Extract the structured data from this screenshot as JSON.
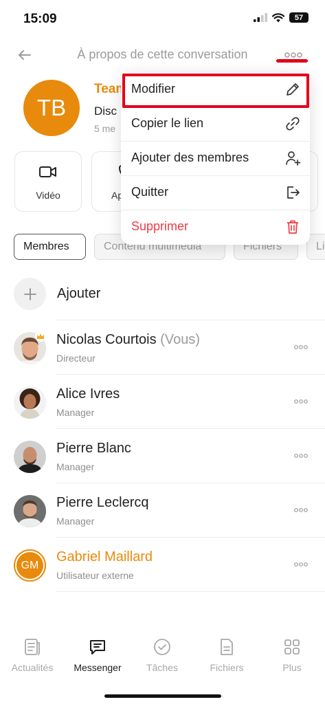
{
  "status_bar": {
    "time": "15:09",
    "battery": "57"
  },
  "header": {
    "title": "À propos de cette conversation"
  },
  "conversation": {
    "initials": "TB",
    "name": "Team",
    "type": "Disc",
    "members": "5 me"
  },
  "actions": [
    {
      "label": "Vidéo",
      "icon": "video-camera-icon"
    },
    {
      "label": "Ap",
      "icon": "phone-icon"
    }
  ],
  "tabs": [
    {
      "label": "Membres",
      "active": true
    },
    {
      "label": "Contenu multimédia",
      "active": false
    },
    {
      "label": "Fichiers",
      "active": false
    },
    {
      "label": "Li",
      "active": false
    }
  ],
  "members_list": {
    "add_label": "Ajouter",
    "members": [
      {
        "name": "Nicolas Courtois",
        "suffix": "(Vous)",
        "role": "Directeur",
        "admin": true
      },
      {
        "name": "Alice Ivres",
        "suffix": "",
        "role": "Manager"
      },
      {
        "name": "Pierre Blanc",
        "suffix": "",
        "role": "Manager"
      },
      {
        "name": "Pierre Leclercq",
        "suffix": "",
        "role": "Manager"
      },
      {
        "name": "Gabriel Maillard",
        "suffix": "",
        "role": "Utilisateur externe",
        "initials": "GM",
        "accent": "#e88a0c"
      }
    ]
  },
  "menu": {
    "items": [
      {
        "label": "Modifier",
        "icon": "pencil-icon"
      },
      {
        "label": "Copier le lien",
        "icon": "link-icon"
      },
      {
        "label": "Ajouter des membres",
        "icon": "add-user-icon"
      },
      {
        "label": "Quitter",
        "icon": "exit-icon"
      },
      {
        "label": "Supprimer",
        "icon": "trash-icon",
        "danger": true
      }
    ]
  },
  "bottom_nav": {
    "items": [
      {
        "label": "Actualités",
        "icon": "news-icon"
      },
      {
        "label": "Messenger",
        "icon": "chat-icon",
        "active": true
      },
      {
        "label": "Tâches",
        "icon": "check-circle-icon"
      },
      {
        "label": "Fichiers",
        "icon": "file-icon"
      },
      {
        "label": "Plus",
        "icon": "grid-icon"
      }
    ]
  },
  "colors": {
    "accent": "#e88a0c",
    "danger": "#f03b45",
    "highlight": "#e3001b"
  }
}
